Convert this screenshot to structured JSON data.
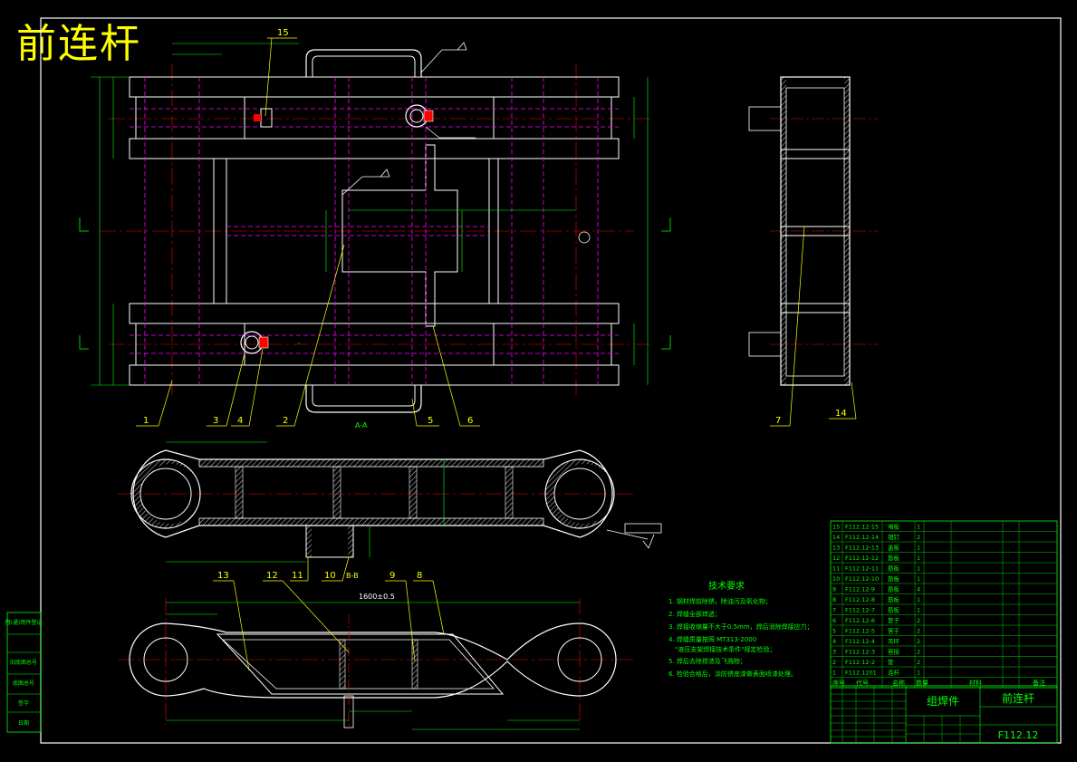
{
  "title": "前连杆",
  "section_labels": {
    "a_a": "A-A",
    "b_b": "B-B"
  },
  "callouts_top": [
    {
      "n": "15"
    },
    {
      "n": "1"
    },
    {
      "n": "3"
    },
    {
      "n": "4"
    },
    {
      "n": "2"
    },
    {
      "n": "5"
    },
    {
      "n": "6"
    },
    {
      "n": "7"
    },
    {
      "n": "14"
    }
  ],
  "callouts_bottom": [
    {
      "n": "13"
    },
    {
      "n": "12"
    },
    {
      "n": "11"
    },
    {
      "n": "10"
    },
    {
      "n": "9"
    },
    {
      "n": "8"
    }
  ],
  "dimension_main": "1600±0.5",
  "tech_requirements": {
    "heading": "技术要求",
    "items": [
      "1. 钢材焊前除锈，除油污及氧化物；",
      "2. 焊缝全部焊透；",
      "3. 焊接收缩量不大于0.5mm，焊后消除焊接应力；",
      "4. 焊缝质量按照 MT313-2000",
      "\"液压支架焊接技术条件\"规定检验；",
      "5. 焊后去除焊渣及飞溅物；",
      "6. 检验合格后，涂防锈底漆做表面喷漆处理。"
    ]
  },
  "bom": {
    "rows": [
      {
        "no": "15",
        "code": "F112.12-15",
        "name": "堵板",
        "qty": "1"
      },
      {
        "no": "14",
        "code": "F112.12-14",
        "name": "销钉",
        "qty": "2"
      },
      {
        "no": "13",
        "code": "F112.12-13",
        "name": "盖板",
        "qty": "1"
      },
      {
        "no": "12",
        "code": "F112.12-12",
        "name": "筋板",
        "qty": "1"
      },
      {
        "no": "11",
        "code": "F112.12-11",
        "name": "筋板",
        "qty": "1"
      },
      {
        "no": "10",
        "code": "F112.12-10",
        "name": "筋板",
        "qty": "1"
      },
      {
        "no": "9",
        "code": "F112.12-9",
        "name": "筋板",
        "qty": "4"
      },
      {
        "no": "8",
        "code": "F112.12-8",
        "name": "筋板",
        "qty": "1"
      },
      {
        "no": "7",
        "code": "F112.12-7",
        "name": "筋板",
        "qty": "1"
      },
      {
        "no": "6",
        "code": "F112.12-6",
        "name": "管子",
        "qty": "2"
      },
      {
        "no": "5",
        "code": "F112.12-5",
        "name": "管子",
        "qty": "2"
      },
      {
        "no": "4",
        "code": "F112.12-4",
        "name": "吊环",
        "qty": "2"
      },
      {
        "no": "3",
        "code": "F112.12-3",
        "name": "管接",
        "qty": "2"
      },
      {
        "no": "2",
        "code": "F112.12-2",
        "name": "管",
        "qty": "2"
      },
      {
        "no": "1",
        "code": "F112.1201",
        "name": "连杆",
        "qty": "1"
      }
    ],
    "header": {
      "no": "序号",
      "code": "代号",
      "name": "名称",
      "qty": "数量",
      "material": "材料",
      "note": "备注"
    },
    "assembly_label": "组焊件",
    "part_name": "前连杆",
    "drawing_no": "F112.12"
  },
  "left_strip": [
    "借(通)用件登记",
    "旧底图总号",
    "底图总号",
    "签字",
    "日期"
  ],
  "colors": {
    "outline": "#ffffff",
    "centerline": "#ff0000",
    "hidden": "#ff00ff",
    "dimension": "#00ff00",
    "callout": "#ffff00",
    "frame": "#ffffff",
    "teal": "#00ffff"
  }
}
